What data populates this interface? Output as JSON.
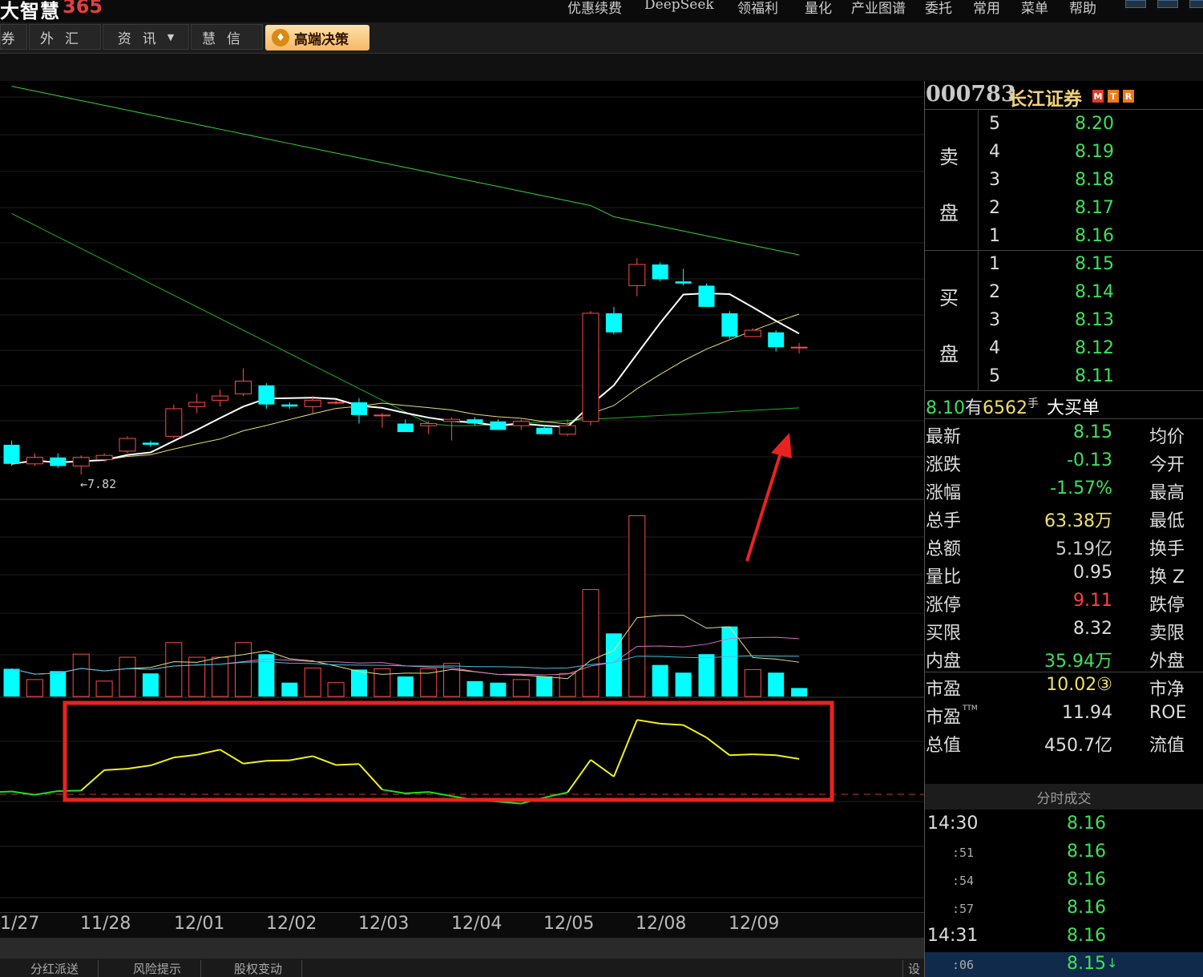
{
  "app": {
    "logo_text": "大智慧",
    "logo_num": "365",
    "menu": [
      "优惠续费",
      "DeepSeek",
      "领福利",
      "量化",
      "产业图谱",
      "委托",
      "常用",
      "菜单",
      "帮助"
    ]
  },
  "tabs": [
    "券",
    "外汇",
    "资讯",
    "慧信"
  ],
  "premium_tab": "高端决策",
  "chart": {
    "low_marker": "←7.82",
    "dates": [
      "1/27",
      "11/28",
      "12/01",
      "12/02",
      "12/03",
      "12/04",
      "12/05",
      "12/08",
      "12/09"
    ],
    "candles": [
      {
        "o": 7.96,
        "c": 7.87,
        "h": 7.98,
        "l": 7.86
      },
      {
        "o": 7.87,
        "c": 7.9,
        "h": 7.92,
        "l": 7.86
      },
      {
        "o": 7.9,
        "c": 7.86,
        "h": 7.92,
        "l": 7.85
      },
      {
        "o": 7.86,
        "c": 7.9,
        "h": 7.91,
        "l": 7.82
      },
      {
        "o": 7.89,
        "c": 7.91,
        "h": 7.92,
        "l": 7.88
      },
      {
        "o": 7.93,
        "c": 7.99,
        "h": 8.0,
        "l": 7.92
      },
      {
        "o": 7.97,
        "c": 7.96,
        "h": 7.98,
        "l": 7.95
      },
      {
        "o": 8.0,
        "c": 8.13,
        "h": 8.15,
        "l": 7.99
      },
      {
        "o": 8.14,
        "c": 8.16,
        "h": 8.2,
        "l": 8.11
      },
      {
        "o": 8.17,
        "c": 8.19,
        "h": 8.22,
        "l": 8.14
      },
      {
        "o": 8.2,
        "c": 8.26,
        "h": 8.32,
        "l": 8.19
      },
      {
        "o": 8.24,
        "c": 8.15,
        "h": 8.25,
        "l": 8.13
      },
      {
        "o": 8.15,
        "c": 8.14,
        "h": 8.16,
        "l": 8.13
      },
      {
        "o": 8.14,
        "c": 8.17,
        "h": 8.19,
        "l": 8.11
      },
      {
        "o": 8.16,
        "c": 8.16,
        "h": 8.17,
        "l": 8.15
      },
      {
        "o": 8.16,
        "c": 8.1,
        "h": 8.18,
        "l": 8.06
      },
      {
        "o": 8.1,
        "c": 8.1,
        "h": 8.11,
        "l": 8.04
      },
      {
        "o": 8.06,
        "c": 8.02,
        "h": 8.08,
        "l": 8.02
      },
      {
        "o": 8.05,
        "c": 8.06,
        "h": 8.07,
        "l": 8.01
      },
      {
        "o": 8.07,
        "c": 8.08,
        "h": 8.09,
        "l": 7.98
      },
      {
        "o": 8.08,
        "c": 8.06,
        "h": 8.09,
        "l": 8.05
      },
      {
        "o": 8.07,
        "c": 8.03,
        "h": 8.08,
        "l": 8.03
      },
      {
        "o": 8.05,
        "c": 8.07,
        "h": 8.08,
        "l": 8.03
      },
      {
        "o": 8.04,
        "c": 8.01,
        "h": 8.05,
        "l": 8.01
      },
      {
        "o": 8.01,
        "c": 8.05,
        "h": 8.08,
        "l": 8.0
      },
      {
        "o": 8.07,
        "c": 8.58,
        "h": 8.59,
        "l": 8.05
      },
      {
        "o": 8.58,
        "c": 8.49,
        "h": 8.61,
        "l": 8.48
      },
      {
        "o": 8.71,
        "c": 8.81,
        "h": 8.84,
        "l": 8.66
      },
      {
        "o": 8.81,
        "c": 8.74,
        "h": 8.82,
        "l": 8.73
      },
      {
        "o": 8.73,
        "c": 8.72,
        "h": 8.79,
        "l": 8.71
      },
      {
        "o": 8.71,
        "c": 8.61,
        "h": 8.72,
        "l": 8.61
      },
      {
        "o": 8.58,
        "c": 8.47,
        "h": 8.59,
        "l": 8.46
      },
      {
        "o": 8.47,
        "c": 8.5,
        "h": 8.51,
        "l": 8.47
      },
      {
        "o": 8.49,
        "c": 8.42,
        "h": 8.5,
        "l": 8.4
      },
      {
        "o": 8.42,
        "c": 8.42,
        "h": 8.44,
        "l": 8.39
      }
    ],
    "volumes": [
      {
        "v": 0.36,
        "up": false
      },
      {
        "v": 0.22,
        "up": true
      },
      {
        "v": 0.33,
        "up": false
      },
      {
        "v": 0.55,
        "up": true
      },
      {
        "v": 0.2,
        "up": true
      },
      {
        "v": 0.51,
        "up": true
      },
      {
        "v": 0.3,
        "up": false
      },
      {
        "v": 0.7,
        "up": true
      },
      {
        "v": 0.51,
        "up": true
      },
      {
        "v": 0.51,
        "up": true
      },
      {
        "v": 0.7,
        "up": true
      },
      {
        "v": 0.55,
        "up": false
      },
      {
        "v": 0.18,
        "up": false
      },
      {
        "v": 0.37,
        "up": true
      },
      {
        "v": 0.18,
        "up": true
      },
      {
        "v": 0.35,
        "up": false
      },
      {
        "v": 0.36,
        "up": true
      },
      {
        "v": 0.26,
        "up": false
      },
      {
        "v": 0.36,
        "up": true
      },
      {
        "v": 0.43,
        "up": true
      },
      {
        "v": 0.2,
        "up": false
      },
      {
        "v": 0.18,
        "up": false
      },
      {
        "v": 0.22,
        "up": true
      },
      {
        "v": 0.26,
        "up": false
      },
      {
        "v": 0.3,
        "up": true
      },
      {
        "v": 1.39,
        "up": true
      },
      {
        "v": 0.82,
        "up": false
      },
      {
        "v": 2.35,
        "up": true
      },
      {
        "v": 0.41,
        "up": false
      },
      {
        "v": 0.31,
        "up": false
      },
      {
        "v": 0.55,
        "up": false
      },
      {
        "v": 0.91,
        "up": false
      },
      {
        "v": 0.35,
        "up": true
      },
      {
        "v": 0.31,
        "up": false
      },
      {
        "v": 0.11,
        "up": false
      }
    ],
    "indicator": [
      0.05,
      0.06,
      -0.01,
      0.07,
      0.08,
      0.52,
      0.55,
      0.62,
      0.79,
      0.85,
      0.96,
      0.66,
      0.72,
      0.73,
      0.82,
      0.63,
      0.65,
      0.1,
      0.02,
      0.05,
      -0.04,
      -0.12,
      -0.16,
      -0.2,
      -0.07,
      0.04,
      0.74,
      0.38,
      1.6,
      1.52,
      1.49,
      1.22,
      0.84,
      0.86,
      0.84,
      0.76
    ]
  },
  "stock": {
    "code": "000783",
    "name": "长江证券",
    "badges": [
      "M",
      "T",
      "R"
    ],
    "sell_label": [
      "卖",
      "盘"
    ],
    "buy_label": [
      "买",
      "盘"
    ],
    "sell": [
      {
        "lvl": "5",
        "price": "8.20"
      },
      {
        "lvl": "4",
        "price": "8.19"
      },
      {
        "lvl": "3",
        "price": "8.18"
      },
      {
        "lvl": "2",
        "price": "8.17"
      },
      {
        "lvl": "1",
        "price": "8.16"
      }
    ],
    "buy": [
      {
        "lvl": "1",
        "price": "8.15"
      },
      {
        "lvl": "2",
        "price": "8.14"
      },
      {
        "lvl": "3",
        "price": "8.13"
      },
      {
        "lvl": "4",
        "price": "8.12"
      },
      {
        "lvl": "5",
        "price": "8.11"
      }
    ],
    "big_order": {
      "price": "8.10",
      "word1": "有",
      "qty": "6562",
      "unit": "手",
      "label": "大买单"
    },
    "quotes": [
      {
        "label": "最新",
        "value": "8.15",
        "color": "#3fe05a",
        "rlabel": "均价"
      },
      {
        "label": "涨跌",
        "value": "-0.13",
        "color": "#3fe05a",
        "rlabel": "今开"
      },
      {
        "label": "涨幅",
        "value": "-1.57%",
        "color": "#3fe05a",
        "rlabel": "最高"
      },
      {
        "label": "总手",
        "value": "63.38万",
        "color": "#f0e06a",
        "rlabel": "最低"
      },
      {
        "label": "总额",
        "value": "5.19亿",
        "color": "#cccccc",
        "rlabel": "换手"
      },
      {
        "label": "量比",
        "value": "0.95",
        "color": "#dddddd",
        "rlabel": "换 Z"
      },
      {
        "label": "涨停",
        "value": "9.11",
        "color": "#ff4040",
        "rlabel": "跌停"
      },
      {
        "label": "买限",
        "value": "8.32",
        "color": "#dddddd",
        "rlabel": "卖限"
      },
      {
        "label": "内盘",
        "value": "35.94万",
        "color": "#3fe05a",
        "rlabel": "外盘"
      },
      {
        "label": "市盈",
        "value": "10.02③",
        "color": "#f0e06a",
        "rlabel": "市净"
      },
      {
        "label": "市盈",
        "sup": "TTM",
        "value": "11.94",
        "color": "#dddddd",
        "rlabel": "ROE"
      },
      {
        "label": "总值",
        "value": "450.7亿",
        "color": "#dddddd",
        "rlabel": "流值"
      }
    ]
  },
  "ticks": {
    "header": "分时成交",
    "rows": [
      {
        "time": "14:30",
        "big": true,
        "price": "8.16"
      },
      {
        "time": ":51",
        "big": false,
        "price": "8.16"
      },
      {
        "time": ":54",
        "big": false,
        "price": "8.16"
      },
      {
        "time": ":57",
        "big": false,
        "price": "8.16"
      },
      {
        "time": "14:31",
        "big": true,
        "price": "8.16"
      },
      {
        "time": ":06",
        "big": false,
        "price": "8.15",
        "arrow": "↓"
      }
    ]
  },
  "bottom_tabs": [
    "分红派送",
    "风险提示",
    "股权变动"
  ],
  "bottom_right": "设",
  "colors": {
    "up": "#ff4b4b",
    "down": "#00ffff",
    "ma5": "#ffffff",
    "ma10": "#e6e07a",
    "ma20": "#1fb01f",
    "ma60": "#36d236",
    "highlight": "#e8231f"
  }
}
